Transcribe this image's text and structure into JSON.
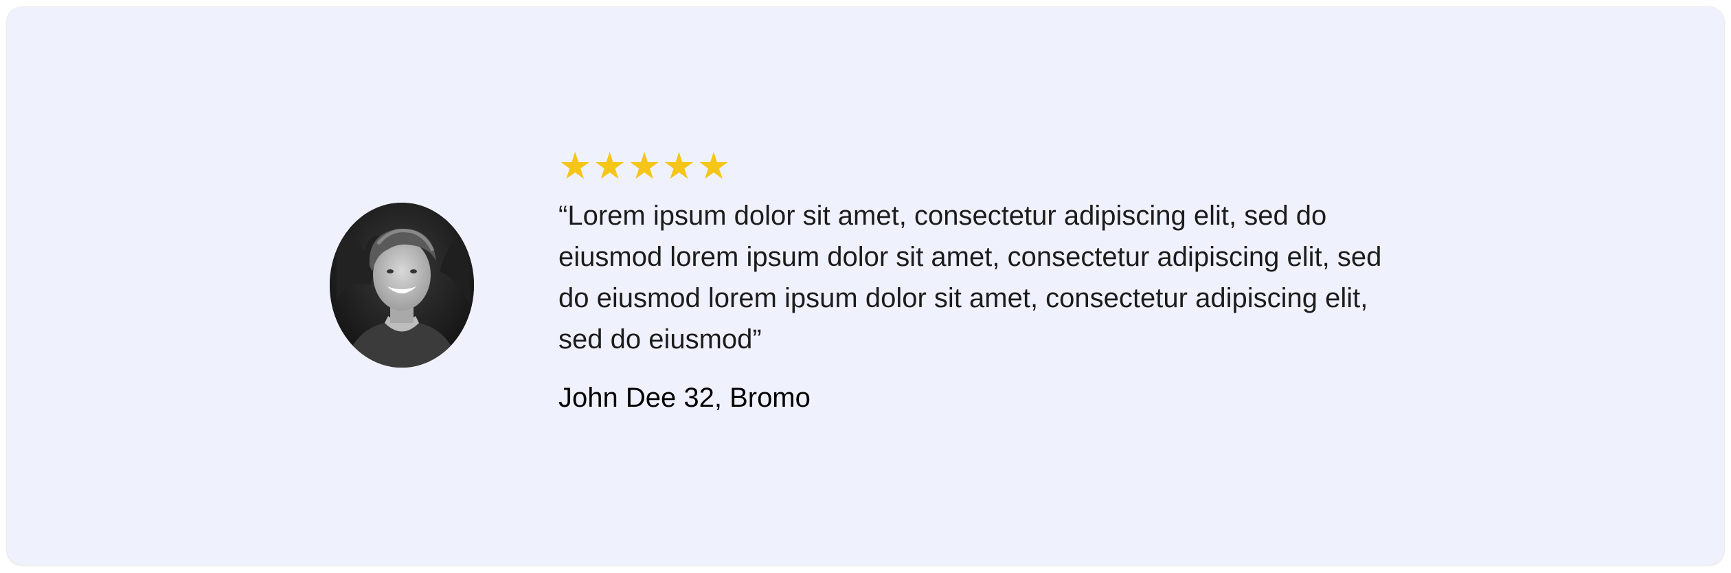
{
  "testimonial": {
    "rating": 5,
    "rating_max": 5,
    "star_glyph": "★",
    "star_color": "#f5c518",
    "quote": "“Lorem ipsum dolor sit amet, consectetur adipiscing elit, sed do eiusmod lorem ipsum dolor sit amet, consectetur adipiscing elit, sed do eiusmod lorem ipsum dolor sit amet, consectetur adipiscing elit, sed do eiusmod”",
    "author": "John Dee 32, Bromo",
    "avatar_icon": "person-photo-icon"
  },
  "colors": {
    "card_background": "#eff2fd",
    "text": "#1c1c1c"
  }
}
